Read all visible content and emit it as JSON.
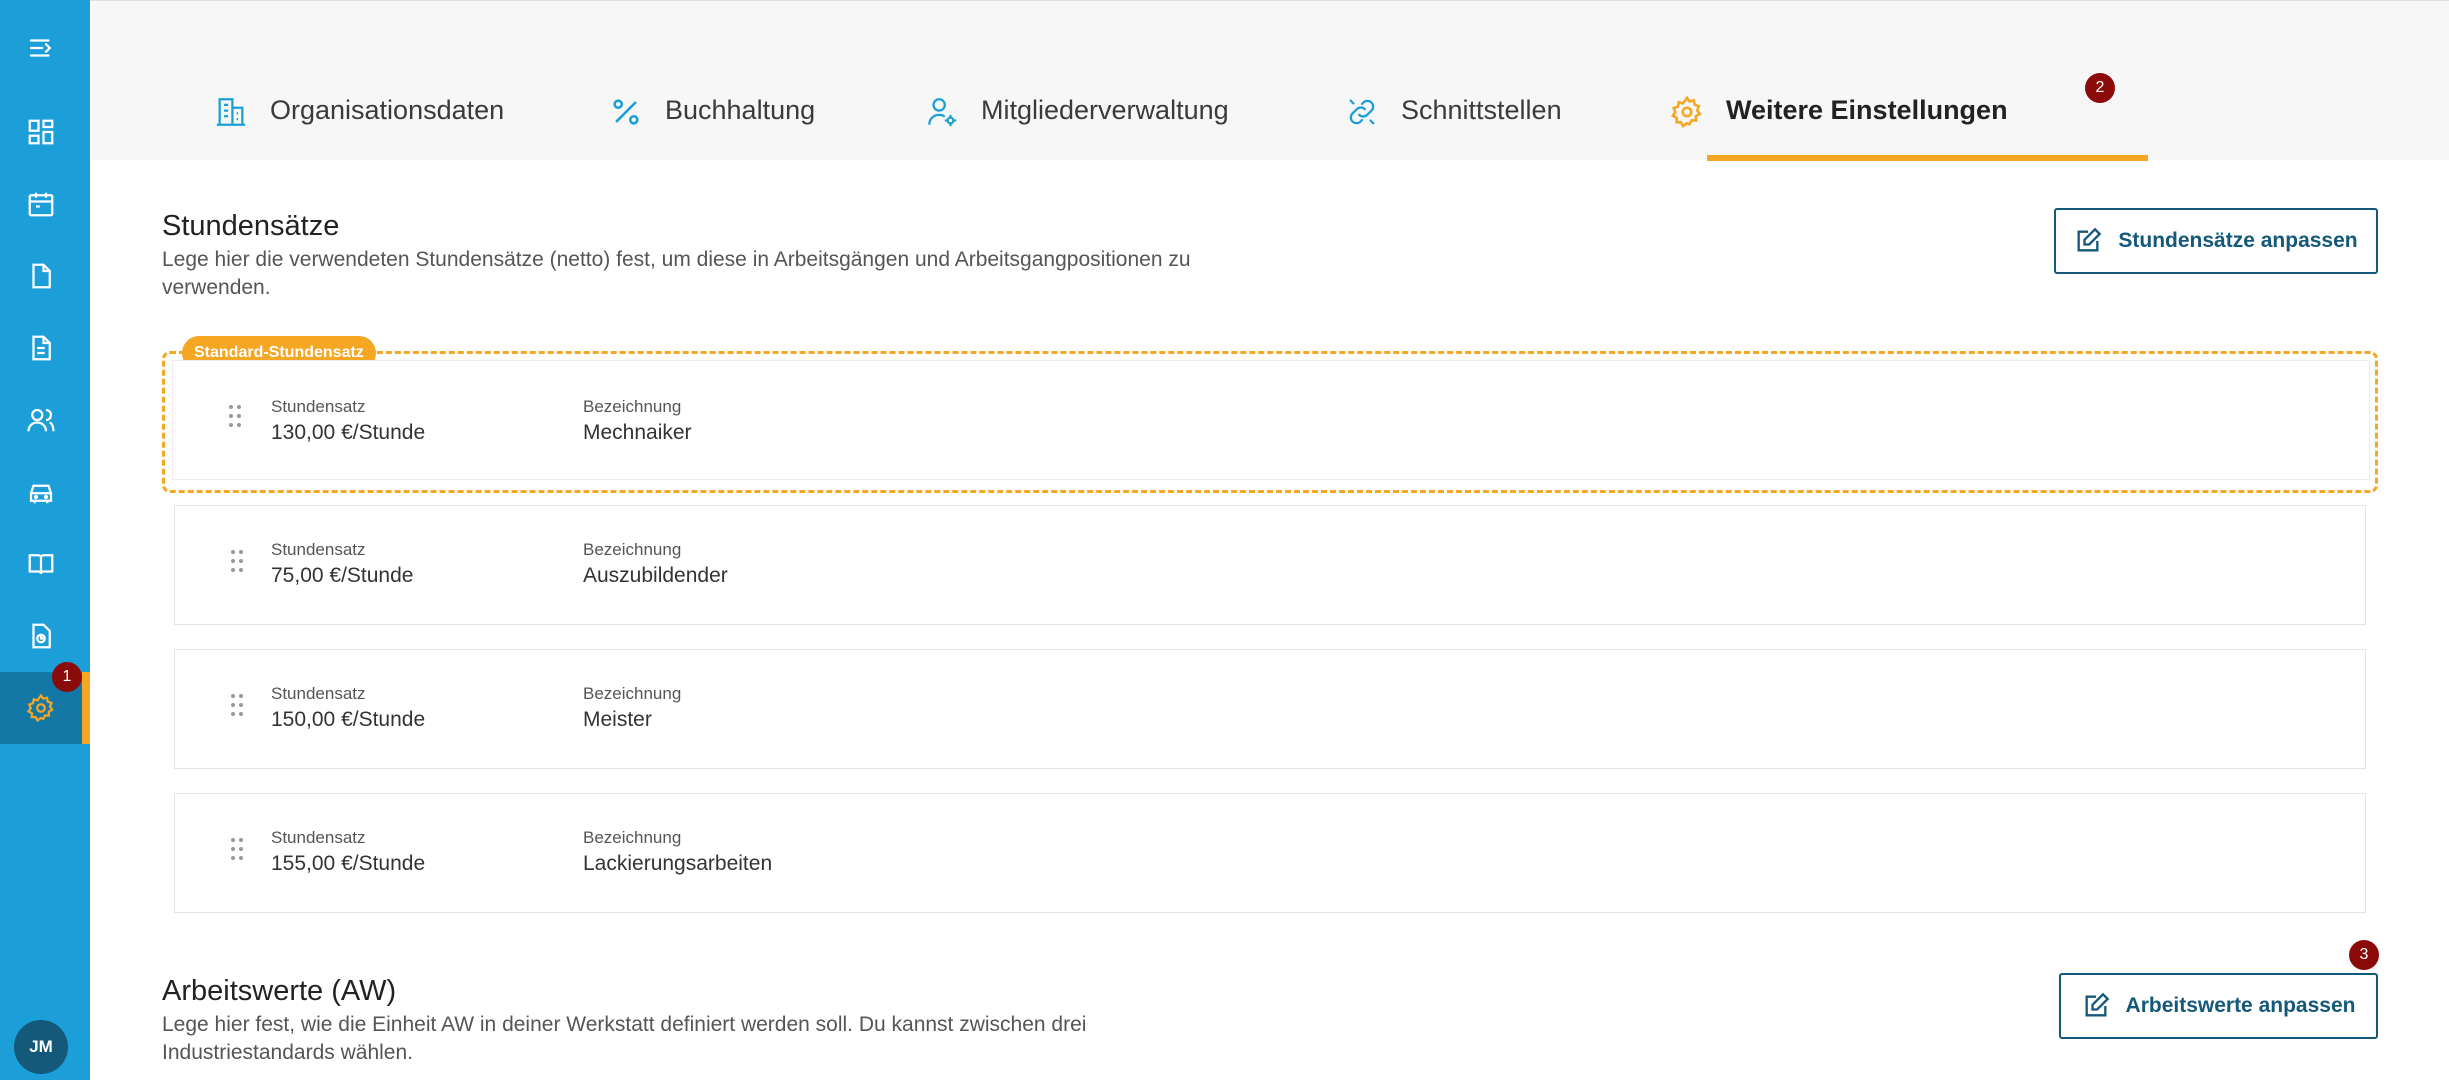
{
  "sidebar": {
    "items": [
      {
        "icon": "menu-expand-icon"
      },
      {
        "icon": "dashboard-icon"
      },
      {
        "icon": "calendar-icon"
      },
      {
        "icon": "document-icon"
      },
      {
        "icon": "invoice-icon"
      },
      {
        "icon": "users-icon"
      },
      {
        "icon": "car-icon"
      },
      {
        "icon": "book-icon"
      },
      {
        "icon": "report-icon"
      },
      {
        "icon": "gear-icon"
      }
    ],
    "active_badge": "1",
    "avatar_initials": "JM",
    "accent_color": "#f5a623",
    "background_color": "#1c9fd8"
  },
  "tabs": [
    {
      "label": "Organisationsdaten",
      "icon": "building-icon"
    },
    {
      "label": "Buchhaltung",
      "icon": "percent-icon"
    },
    {
      "label": "Mitgliederverwaltung",
      "icon": "user-gear-icon"
    },
    {
      "label": "Schnittstellen",
      "icon": "link-icon"
    },
    {
      "label": "Weitere Einstellungen",
      "icon": "gear-icon",
      "active": true,
      "badge": "2"
    }
  ],
  "hourly_rates": {
    "title": "Stundensätze",
    "description": "Lege hier die verwendeten Stundensätze (netto) fest, um diese in Arbeitsgängen und Arbeitsgangpositionen zu verwenden.",
    "button_label": "Stundensätze anpassen",
    "default_tag": "Standard-Stundensatz",
    "rate_label": "Stundensatz",
    "name_label": "Bezeichnung",
    "rows": [
      {
        "rate": "130,00 €/Stunde",
        "name": "Mechnaiker"
      },
      {
        "rate": "75,00 €/Stunde",
        "name": "Auszubildender"
      },
      {
        "rate": "150,00 €/Stunde",
        "name": "Meister"
      },
      {
        "rate": "155,00 €/Stunde",
        "name": "Lackierungsarbeiten"
      }
    ]
  },
  "work_values": {
    "title": "Arbeitswerte (AW)",
    "description": "Lege hier fest, wie die Einheit AW in deiner Werkstatt definiert werden soll. Du kannst zwischen drei Industriestandards wählen.",
    "button_label": "Arbeitswerte anpassen",
    "badge": "3"
  }
}
